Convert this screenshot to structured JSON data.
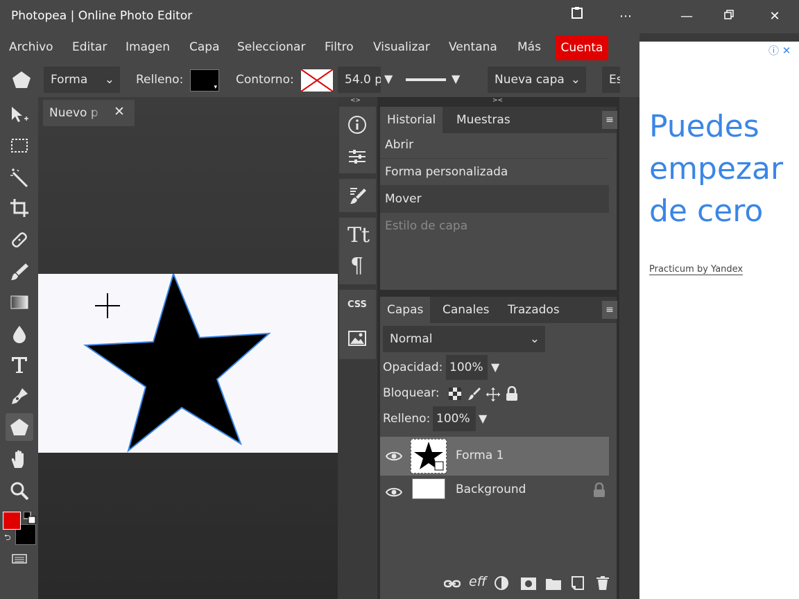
{
  "window": {
    "title": "Photopea | Online Photo Editor"
  },
  "menu": {
    "items": [
      "Archivo",
      "Editar",
      "Imagen",
      "Capa",
      "Seleccionar",
      "Filtro",
      "Visualizar",
      "Ventana",
      "Más"
    ],
    "account": "Cuenta"
  },
  "options": {
    "shape_type": "Forma",
    "fill_label": "Relleno:",
    "stroke_label": "Contorno:",
    "stroke_width": "54.0 p",
    "new_layer": "Nueva capa",
    "extra": "Es"
  },
  "document": {
    "tab_label": "Nuevo p",
    "close": "✕"
  },
  "history": {
    "tabs": [
      "Historial",
      "Muestras"
    ],
    "items": [
      "Abrir",
      "Forma personalizada",
      "Mover",
      "Estilo de capa"
    ]
  },
  "layers": {
    "tabs": [
      "Capas",
      "Canales",
      "Trazados"
    ],
    "blend_mode": "Normal",
    "opacity_label": "Opacidad:",
    "opacity_value": "100%",
    "lock_label": "Bloquear:",
    "fill_label": "Relleno:",
    "fill_value": "100%",
    "rows": [
      {
        "name": "Forma 1",
        "selected": true
      },
      {
        "name": "Background",
        "locked": true
      }
    ],
    "footer_icons": [
      "link-icon",
      "effects-icon",
      "adjustment-icon",
      "mask-icon",
      "folder-icon",
      "new-layer-icon",
      "trash-icon"
    ],
    "effects_text": "eff"
  },
  "strip": {
    "css_label": "CSS"
  },
  "ad": {
    "headline": "Puedes empezar de cero",
    "sponsor": "Practicum by Yandex"
  },
  "colors": {
    "foreground": "#e00000",
    "background": "#000000",
    "account_button": "#e00000",
    "ad_text": "#3b86e6"
  }
}
